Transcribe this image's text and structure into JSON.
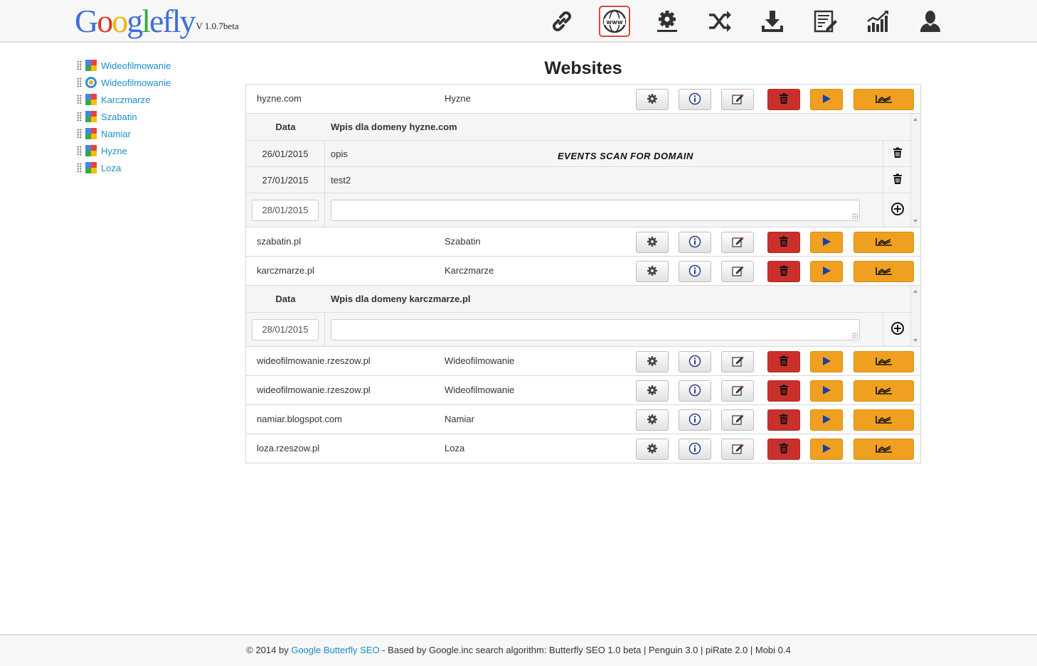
{
  "header": {
    "logo": {
      "g": "G",
      "o1": "o",
      "o2": "o",
      "g2": "g",
      "l": "l",
      "rest": "efly",
      "full": "Googlefly",
      "version": "V 1.0.7beta"
    },
    "icons": [
      {
        "name": "link-icon"
      },
      {
        "name": "www-icon",
        "active": true
      },
      {
        "name": "settings-icon"
      },
      {
        "name": "shuffle-icon"
      },
      {
        "name": "download-icon"
      },
      {
        "name": "notes-icon"
      },
      {
        "name": "stats-icon"
      },
      {
        "name": "user-icon"
      }
    ]
  },
  "sidebar": {
    "items": [
      {
        "label": "Wideofilmowanie",
        "icon": "google-icon"
      },
      {
        "label": "Wideofilmowanie",
        "icon": "bing-icon"
      },
      {
        "label": "Karczmarze",
        "icon": "google-icon"
      },
      {
        "label": "Szabatin",
        "icon": "google-icon"
      },
      {
        "label": "Namiar",
        "icon": "google-icon"
      },
      {
        "label": "Hyzne",
        "icon": "google-icon"
      },
      {
        "label": "Loza",
        "icon": "google-icon"
      }
    ]
  },
  "main": {
    "title": "Websites",
    "sites": [
      {
        "url": "hyzne.com",
        "name": "Hyzne"
      },
      {
        "url": "szabatin.pl",
        "name": "Szabatin"
      },
      {
        "url": "karczmarze.pl",
        "name": "Karczmarze"
      },
      {
        "url": "wideofilmowanie.rzeszow.pl",
        "name": "Wideofilmowanie"
      },
      {
        "url": "wideofilmowanie.rzeszow.pl",
        "name": "Wideofilmowanie"
      },
      {
        "url": "namiar.blogspot.com",
        "name": "Namiar"
      },
      {
        "url": "loza.rzeszow.pl",
        "name": "Loza"
      }
    ],
    "details": {
      "hyzne": {
        "col_date": "Data",
        "col_entry": "Wpis dla domeny hyzne.com",
        "rows": [
          {
            "date": "26/01/2015",
            "text": "opis"
          },
          {
            "date": "27/01/2015",
            "text": "test2"
          }
        ],
        "new_date": "28/01/2015",
        "events_label": "EVENTS SCAN FOR DOMAIN"
      },
      "karczmarze": {
        "col_date": "Data",
        "col_entry": "Wpis dla domeny karczmarze.pl",
        "new_date": "28/01/2015"
      }
    }
  },
  "colors": {
    "accent": "#1a8fc6",
    "red": "#c9302c",
    "orange": "#f0a020",
    "active_border": "#d04a3b"
  },
  "footer": {
    "prefix": "© 2014 by ",
    "link": "Google Butterfly SEO",
    "suffix": " - Based by Google.inc search algorithm: Butterfly SEO 1.0 beta | Penguin 3.0 | piRate 2.0 | Mobi 0.4"
  }
}
